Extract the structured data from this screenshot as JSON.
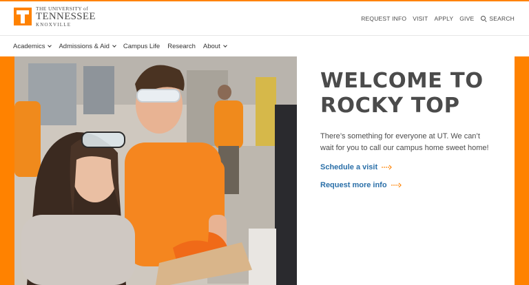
{
  "header": {
    "logo_line1": "THE UNIVERSITY of",
    "logo_line2": "TENNESSEE",
    "logo_line3": "KNOXVILLE",
    "utility_nav": [
      "REQUEST INFO",
      "VISIT",
      "APPLY",
      "GIVE"
    ],
    "search_label": "SEARCH"
  },
  "main_nav": [
    {
      "label": "Academics",
      "dropdown": true
    },
    {
      "label": "Admissions & Aid",
      "dropdown": true
    },
    {
      "label": "Campus Life",
      "dropdown": false
    },
    {
      "label": "Research",
      "dropdown": false
    },
    {
      "label": "About",
      "dropdown": true
    }
  ],
  "hero": {
    "headline_line1": "WELCOME TO",
    "headline_line2": "ROCKY TOP",
    "body": "There’s something for everyone at UT. We can’t wait for you to call our campus home sweet home!",
    "cta_visit": "Schedule a visit",
    "cta_info": "Request more info"
  },
  "colors": {
    "brand_orange": "#ff8200",
    "link_blue": "#2a6fa8",
    "text_gray": "#4b4b4b"
  },
  "icons": {
    "logo": "power-t-logo",
    "search": "search-icon",
    "arrow": "dotted-arrow-icon",
    "chevron": "chevron-down-icon"
  }
}
